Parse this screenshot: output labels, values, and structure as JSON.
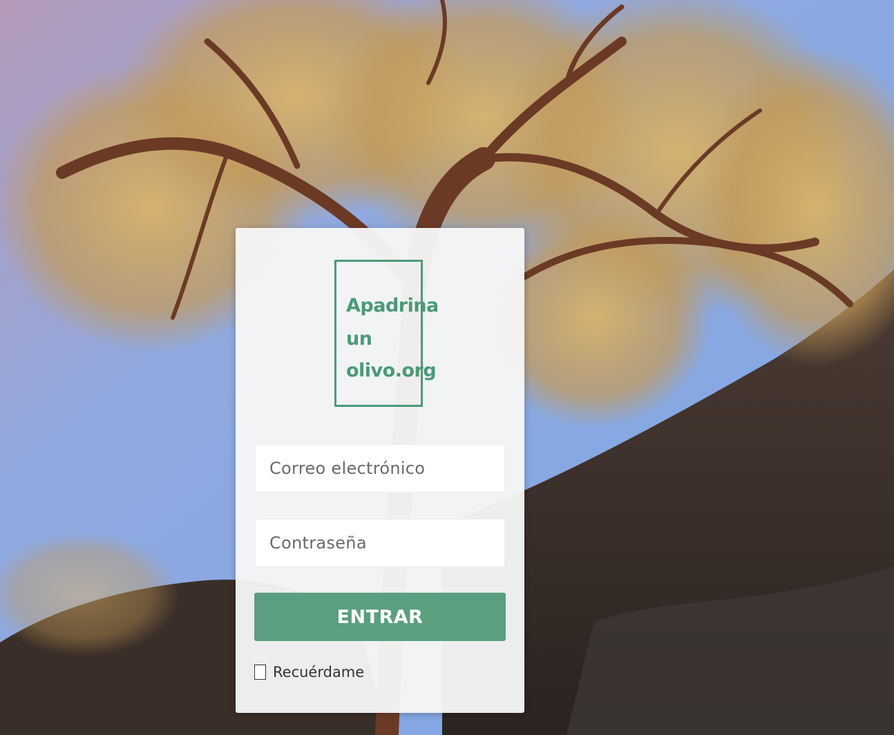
{
  "logo": {
    "lines": [
      "Apadrina",
      "un",
      "olivo.org"
    ],
    "color": "#4a9a78"
  },
  "form": {
    "email_placeholder": "Correo electrónico",
    "password_placeholder": "Contraseña",
    "submit_label": "ENTRAR",
    "remember_label": "Recuérdame",
    "remember_checked": false
  },
  "colors": {
    "accent": "#5a9f7f",
    "sky": "#8fb0e6",
    "branch": "#6b3a25",
    "leaf": "#c9a55e"
  },
  "background": {
    "subject": "olive-tree-photo"
  }
}
